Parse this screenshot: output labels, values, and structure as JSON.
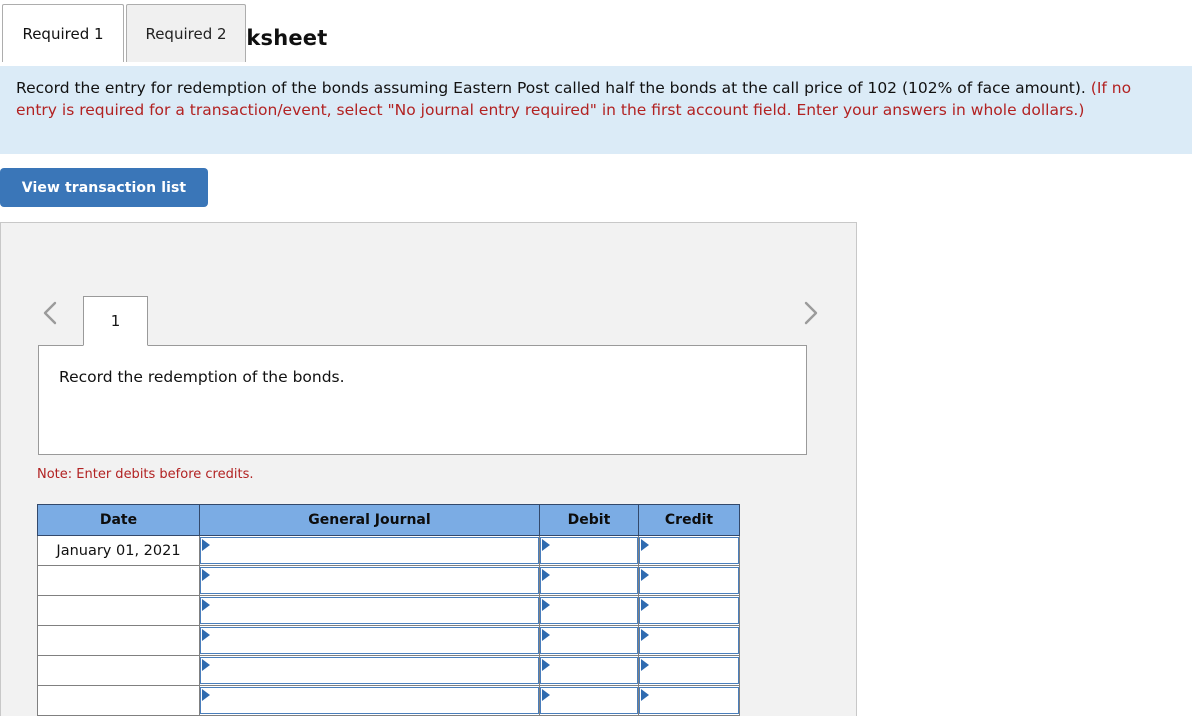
{
  "tabs": [
    {
      "label": "Required 1",
      "active": true
    },
    {
      "label": "Required 2",
      "active": false
    }
  ],
  "instructions": {
    "black_text": "Record the entry for redemption of the bonds assuming Eastern Post called half the bonds at the call price of 102 (102% of face amount).",
    "red_text": "(If no entry is required for a transaction/event, select \"No journal entry required\" in the first account field. Enter your answers in whole dollars.)"
  },
  "toolbar": {
    "view_transaction_list_label": "View transaction list"
  },
  "worksheet": {
    "title": "Journal entry worksheet",
    "prev_icon": "chevron-left-icon",
    "next_icon": "chevron-right-icon",
    "page_tabs": [
      {
        "label": "1",
        "active": true
      }
    ],
    "description": "Record the redemption of the bonds.",
    "note": "Note: Enter debits before credits."
  },
  "journal_table": {
    "headers": [
      "Date",
      "General Journal",
      "Debit",
      "Credit"
    ],
    "rows": [
      {
        "date": "January 01, 2021",
        "general_journal": "",
        "debit": "",
        "credit": ""
      },
      {
        "date": "",
        "general_journal": "",
        "debit": "",
        "credit": ""
      },
      {
        "date": "",
        "general_journal": "",
        "debit": "",
        "credit": ""
      },
      {
        "date": "",
        "general_journal": "",
        "debit": "",
        "credit": ""
      },
      {
        "date": "",
        "general_journal": "",
        "debit": "",
        "credit": ""
      },
      {
        "date": "",
        "general_journal": "",
        "debit": "",
        "credit": ""
      }
    ]
  },
  "colors": {
    "banner_bg": "#dbebf7",
    "accent_blue": "#3a76b8",
    "table_header_blue": "#7bace4",
    "note_red": "#b22222",
    "panel_bg": "#f2f2f2",
    "input_border_blue": "#4a7ebb"
  }
}
